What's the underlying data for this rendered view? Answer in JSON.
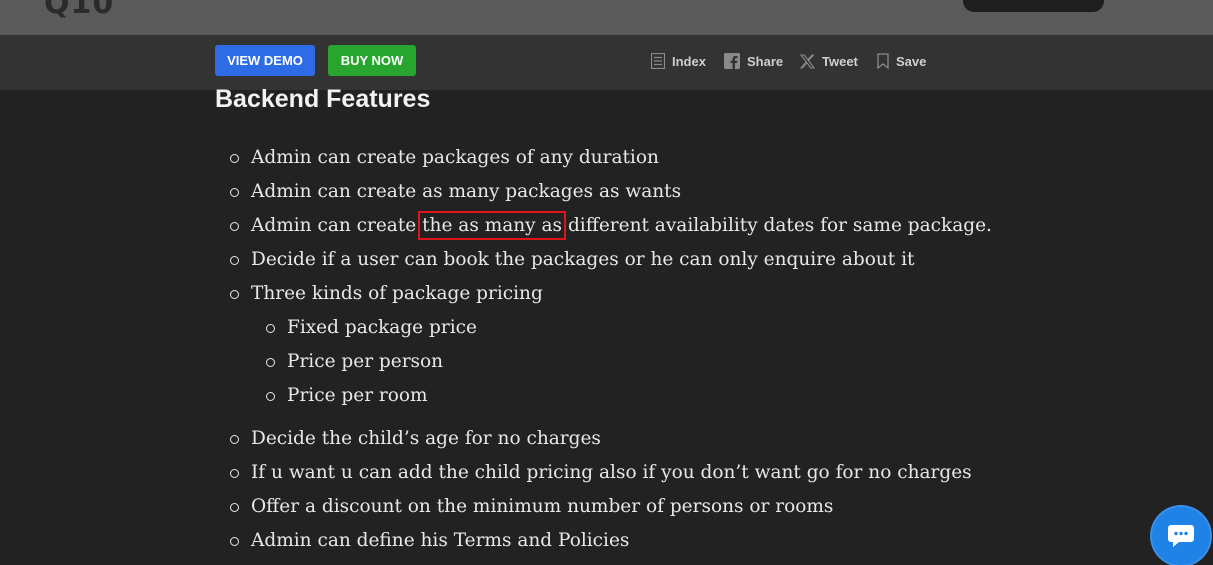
{
  "header": {
    "logo_text": "Q10"
  },
  "actionbar": {
    "view_demo": "VIEW DEMO",
    "buy_now": "BUY NOW",
    "tools": [
      {
        "label": "Index",
        "icon": "index-icon"
      },
      {
        "label": "Share",
        "icon": "facebook-icon"
      },
      {
        "label": "Tweet",
        "icon": "x-icon"
      },
      {
        "label": "Save",
        "icon": "bookmark-icon"
      }
    ]
  },
  "article": {
    "heading": "Backend Features",
    "items": [
      "Admin can create packages of any duration",
      "Admin can create as many packages as wants",
      {
        "before": "Admin can create",
        "highlight": "the as many as",
        "after": "different availability dates for same package."
      },
      "Decide if a user can book the packages or he can only enquire about it",
      "Three kinds of package pricing",
      "Decide the child’s age for no charges",
      "If u want u can add the child pricing also if you don’t want go for no charges",
      "Offer a discount on the minimum number of persons or rooms",
      "Admin can define his Terms and Policies"
    ],
    "pricing_subitems": [
      "Fixed package price",
      "Price per person",
      "Price per room"
    ]
  },
  "colors": {
    "background": "#222222",
    "view_demo": "#2e6ce6",
    "buy_now": "#27a52f",
    "highlight_box": "#e0141c",
    "chat": "#1f82e6"
  },
  "chat_icon": "chat-bubble-icon"
}
